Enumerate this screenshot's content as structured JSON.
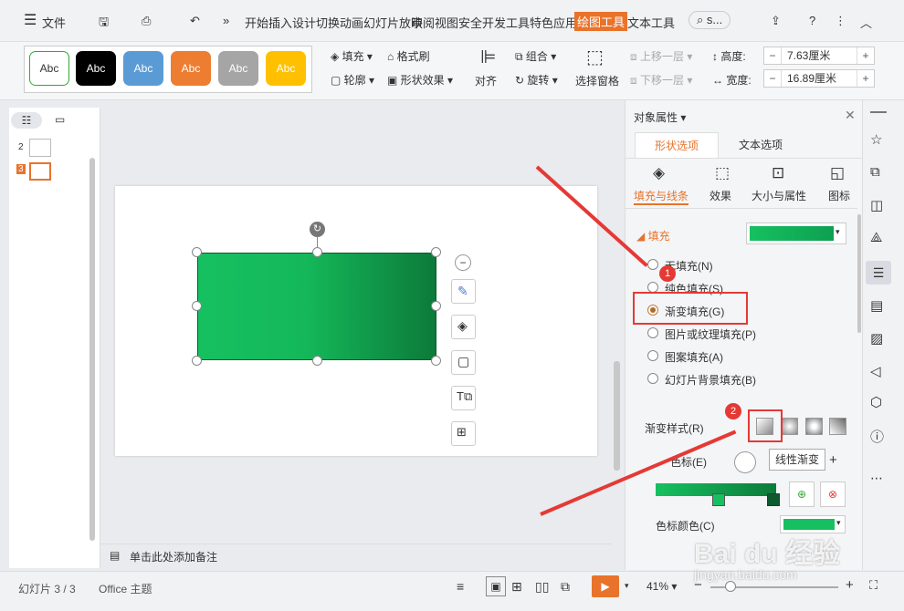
{
  "menubar": {
    "file": "文件",
    "items": [
      "开始",
      "插入",
      "设计",
      "切换",
      "动画",
      "幻灯片放映",
      "审阅",
      "视图",
      "安全",
      "开发工具",
      "特色应用",
      "绘图工具",
      "文本工具"
    ],
    "search": "s..."
  },
  "ribbon": {
    "styles": [
      "Abc",
      "Abc",
      "Abc",
      "Abc",
      "Abc",
      "Abc"
    ],
    "fill": "填充",
    "format_brush": "格式刷",
    "outline": "轮廓",
    "shape_effect": "形状效果",
    "align": "对齐",
    "group": "组合",
    "rotate": "旋转",
    "selection_pane": "选择窗格",
    "bring_forward": "上移一层",
    "send_backward": "下移一层",
    "height_label": "高度:",
    "height_value": "7.63厘米",
    "width_label": "宽度:",
    "width_value": "16.89厘米"
  },
  "slides": {
    "numbers": [
      "2",
      "3"
    ]
  },
  "notes": {
    "placeholder": "单击此处添加备注"
  },
  "panel": {
    "title": "对象属性",
    "tabs": [
      "形状选项",
      "文本选项"
    ],
    "subtabs": [
      "填充与线条",
      "效果",
      "大小与属性",
      "图标"
    ],
    "fill_section": "填充",
    "options": [
      "无填充(N)",
      "纯色填充(S)",
      "渐变填充(G)",
      "图片或纹理填充(P)",
      "图案填充(A)",
      "幻灯片背景填充(B)"
    ],
    "gradient_style_label": "渐变样式(R)",
    "color_label": "色标(E)",
    "tooltip": "线性渐变",
    "stop_color_label": "色标颜色(C)"
  },
  "annotations": {
    "badge1": "1",
    "badge2": "2"
  },
  "status": {
    "slide_info": "幻灯片 3 / 3",
    "theme": "Office 主题",
    "zoom": "41%"
  },
  "watermark": {
    "text": "Bai du 经验",
    "url": "jingyan.baidu.com"
  },
  "colors": {
    "accent": "#e8732b",
    "gradient_start": "#16c060",
    "gradient_end": "#0d7a3a",
    "annotation": "#e53935"
  }
}
